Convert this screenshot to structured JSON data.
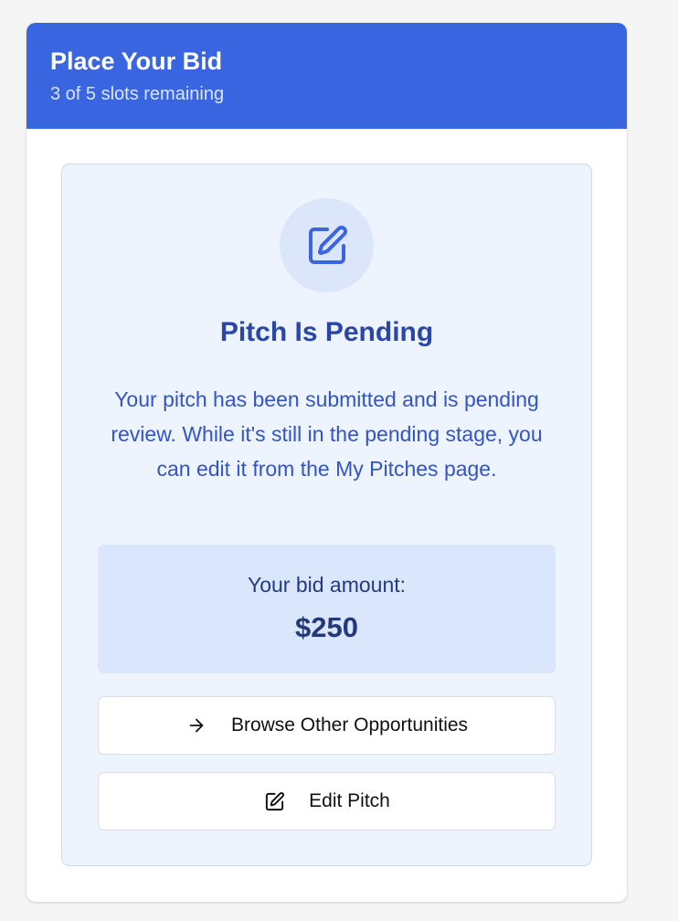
{
  "header": {
    "title": "Place Your Bid",
    "subtitle": "3 of 5 slots remaining"
  },
  "status": {
    "icon": "edit-icon",
    "title": "Pitch Is Pending",
    "message": "Your pitch has been submitted and is pending review. While it's still in the pending stage, you can edit it from the My Pitches page."
  },
  "bid": {
    "label": "Your bid amount:",
    "amount": "$250"
  },
  "actions": {
    "browse_label": "Browse Other Opportunities",
    "browse_icon": "arrow-right-icon",
    "edit_label": "Edit Pitch",
    "edit_icon": "edit-icon"
  },
  "colors": {
    "header_bg": "#3a65e1",
    "panel_bg": "#eef4fd",
    "accent": "#3354c9",
    "bid_box_bg": "#dae6fb"
  }
}
